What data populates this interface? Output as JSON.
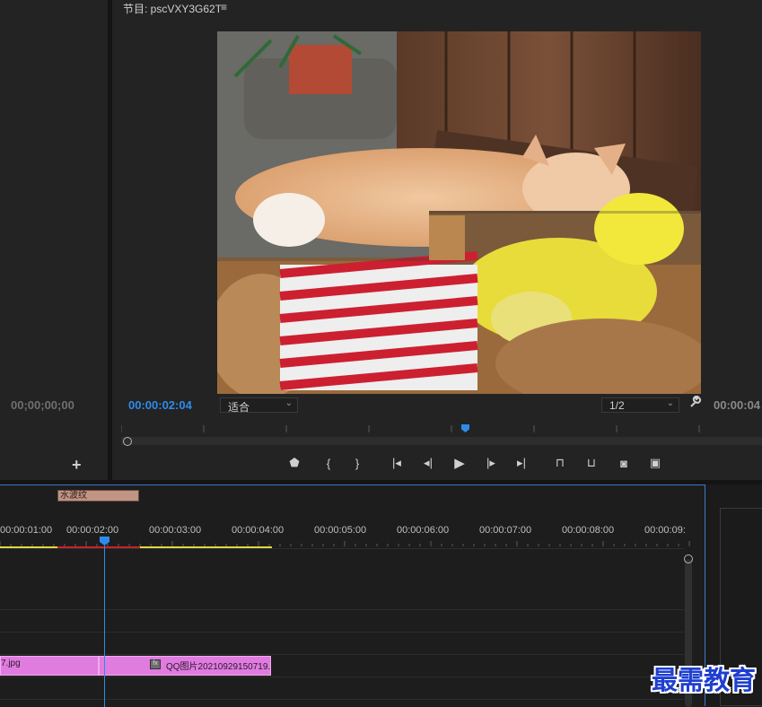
{
  "source_panel": {
    "timecode": "00;00;00;00",
    "add_button": "+"
  },
  "program_monitor": {
    "title": "节目: pscVXY3G62T",
    "menu_icon": "≡",
    "current_timecode": "00:00:02:04",
    "fit_select": "适合",
    "zoom_select": "1/2",
    "end_timecode": "00:00:04",
    "wrench_icon": "🔧",
    "transport": [
      {
        "name": "add-marker-button",
        "icon": "marker-icon"
      },
      {
        "name": "mark-in-button",
        "icon": "mark-in-icon"
      },
      {
        "name": "mark-out-button",
        "icon": "mark-out-icon"
      },
      {
        "name": "go-to-in-button",
        "icon": "go-to-in-icon"
      },
      {
        "name": "step-back-button",
        "icon": "step-back-icon"
      },
      {
        "name": "play-button",
        "icon": "play-icon"
      },
      {
        "name": "step-forward-button",
        "icon": "step-forward-icon"
      },
      {
        "name": "go-to-out-button",
        "icon": "go-to-out-icon"
      },
      {
        "name": "lift-button",
        "icon": "lift-icon"
      },
      {
        "name": "extract-button",
        "icon": "extract-icon"
      },
      {
        "name": "export-frame-button",
        "icon": "camera-icon"
      },
      {
        "name": "comparison-view-button",
        "icon": "comparison-icon"
      }
    ]
  },
  "timeline": {
    "time_labels": [
      "00:00:01:00",
      "00:00:02:00",
      "00:00:03:00",
      "00:00:04:00",
      "00:00:05:00",
      "00:00:06:00",
      "00:00:07:00",
      "00:00:08:00",
      "00:00:09:"
    ],
    "clips": [
      {
        "label": "7.jpg"
      },
      {
        "label": "QQ图片20210929150719."
      }
    ],
    "effect_label": "水波纹",
    "fx_badge": "fx"
  },
  "watermark": "最需教育",
  "colors": {
    "accent": "#2d8ceb",
    "clip_pink": "#e07be0",
    "render_yellow": "#e3d640",
    "render_red": "#c8232a"
  }
}
